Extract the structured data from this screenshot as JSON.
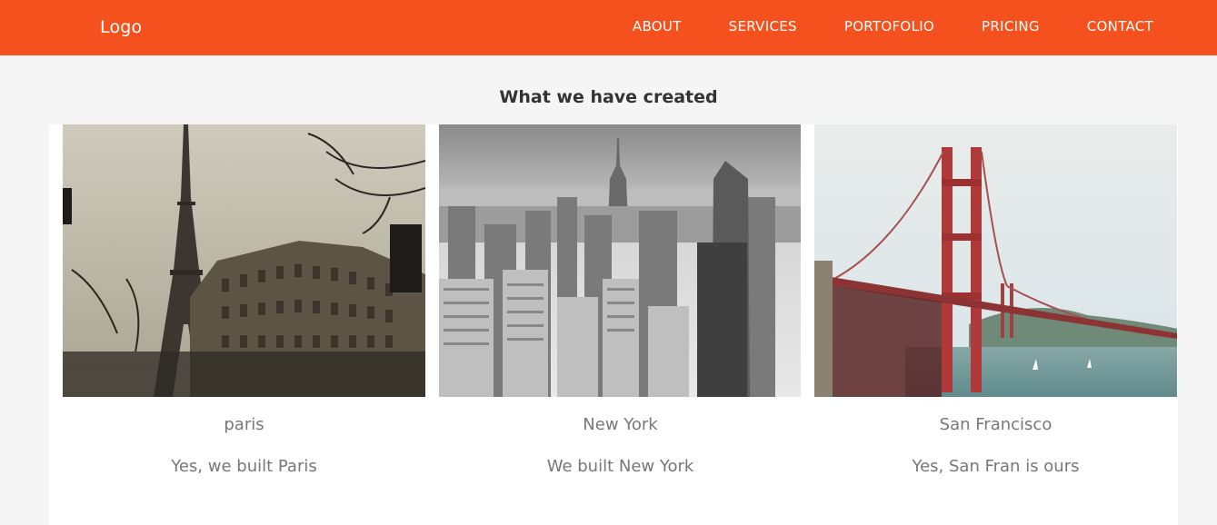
{
  "nav": {
    "logo": "Logo",
    "links": [
      "ABOUT",
      "SERVICES",
      "PORTOFOLIO",
      "PRICING",
      "CONTACT"
    ],
    "background": "#f4511e"
  },
  "section": {
    "title": "What we have created"
  },
  "cards": [
    {
      "city": "paris",
      "caption": "Yes, we built Paris",
      "image": "eiffel-tower-photo"
    },
    {
      "city": "New York",
      "caption": "We built New York",
      "image": "new-york-skyline-photo"
    },
    {
      "city": "San Francisco",
      "caption": "Yes, San Fran is ours",
      "image": "golden-gate-bridge-photo"
    }
  ]
}
